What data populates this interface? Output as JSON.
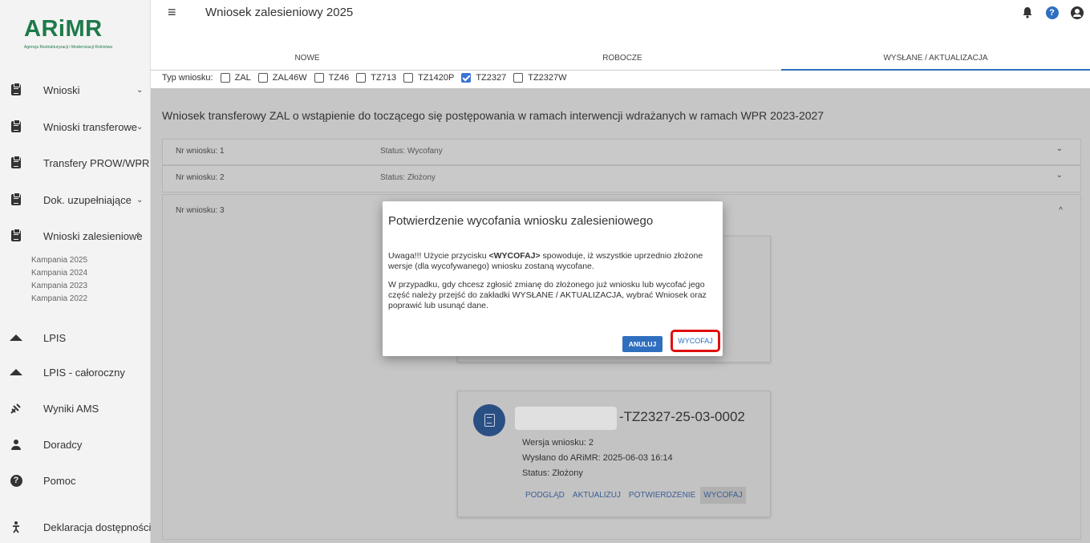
{
  "logo": {
    "text": "ARiMR",
    "subtitle": "Agencja Restrukturyzacji i Modernizacji Rolnictwa"
  },
  "colors": {
    "brand_green": "#1d7a4a",
    "accent_blue": "#2f6fbf",
    "highlight_red": "#e01010",
    "icon_navy": "#2a4f84"
  },
  "header": {
    "title": "Wniosek zalesieniowy 2025",
    "icons": [
      "menu-icon",
      "bell-icon",
      "help-icon",
      "account-icon"
    ]
  },
  "tabs": [
    "NOWE",
    "ROBOCZE",
    "WYSŁANE / AKTUALIZACJA"
  ],
  "active_tab": "WYSŁANE / AKTUALIZACJA",
  "filter": {
    "label": "Typ wniosku:",
    "options": [
      {
        "label": "ZAL",
        "checked": false
      },
      {
        "label": "ZAL46W",
        "checked": false
      },
      {
        "label": "TZ46",
        "checked": false
      },
      {
        "label": "TZ713",
        "checked": false
      },
      {
        "label": "TZ1420P",
        "checked": false
      },
      {
        "label": "TZ2327",
        "checked": true
      },
      {
        "label": "TZ2327W",
        "checked": false
      }
    ]
  },
  "sidebar": {
    "items": [
      {
        "label": "Wnioski",
        "icon": "clipboard-icon",
        "chevron": "⌄"
      },
      {
        "label": "Wnioski transferowe",
        "icon": "clipboard-icon",
        "chevron": "⌄"
      },
      {
        "label": "Transfery PROW/WPR",
        "icon": "clipboard-icon",
        "chevron": "⌄"
      },
      {
        "label": "Dok. uzupełniające",
        "icon": "clipboard-icon",
        "chevron": "⌄"
      },
      {
        "label": "Wnioski zalesieniowe",
        "icon": "clipboard-icon",
        "chevron": "^"
      },
      {
        "label": "LPIS",
        "icon": "terrain-icon"
      },
      {
        "label": "LPIS - całoroczny",
        "icon": "terrain-icon"
      },
      {
        "label": "Wyniki AMS",
        "icon": "satellite-icon"
      },
      {
        "label": "Doradcy",
        "icon": "person-icon"
      },
      {
        "label": "Pomoc",
        "icon": "help-circle-icon"
      },
      {
        "label": "Deklaracja dostępności",
        "icon": "accessibility-icon"
      }
    ],
    "subitems": [
      "Kampania 2025",
      "Kampania 2024",
      "Kampania 2023",
      "Kampania 2022"
    ]
  },
  "main": {
    "section_title": "Wniosek transferowy ZAL o wstąpienie do toczącego się postępowania w ramach interwencji wdrażanych w ramach WPR 2023-2027",
    "rows": [
      {
        "number": "Nr wniosku: 1",
        "status": "Status: Wycofany"
      },
      {
        "number": "Nr wniosku: 2",
        "status": "Status: Złożony"
      },
      {
        "number": "Nr wniosku: 3",
        "status": ""
      }
    ],
    "card": {
      "title": "-TZ2327-25-03-0002",
      "version": "Wersja wniosku: 2",
      "sent": "Wysłano do ARiMR: 2025-06-03 16:14",
      "status": "Status: Złożony",
      "actions": [
        "PODGLĄD",
        "AKTUALIZUJ",
        "POTWIERDZENIE",
        "WYCOFAJ"
      ]
    }
  },
  "modal": {
    "title": "Potwierdzenie wycofania wniosku zalesieniowego",
    "p1_prefix": "Uwaga!!! Użycie przycisku ",
    "p1_bold": "<WYCOFAJ>",
    "p1_suffix": " spowoduje, iż wszystkie uprzednio złożone wersje (dla wycofywanego) wniosku zostaną wycofane.",
    "p2": "W przypadku, gdy chcesz zgłosić zmianę do złożonego już wniosku lub wycofać jego część należy przejść do zakładki WYSŁANE / AKTUALIZACJA, wybrać Wniosek oraz poprawić lub usunąć dane.",
    "cancel": "ANULUJ",
    "confirm": "WYCOFAJ"
  }
}
